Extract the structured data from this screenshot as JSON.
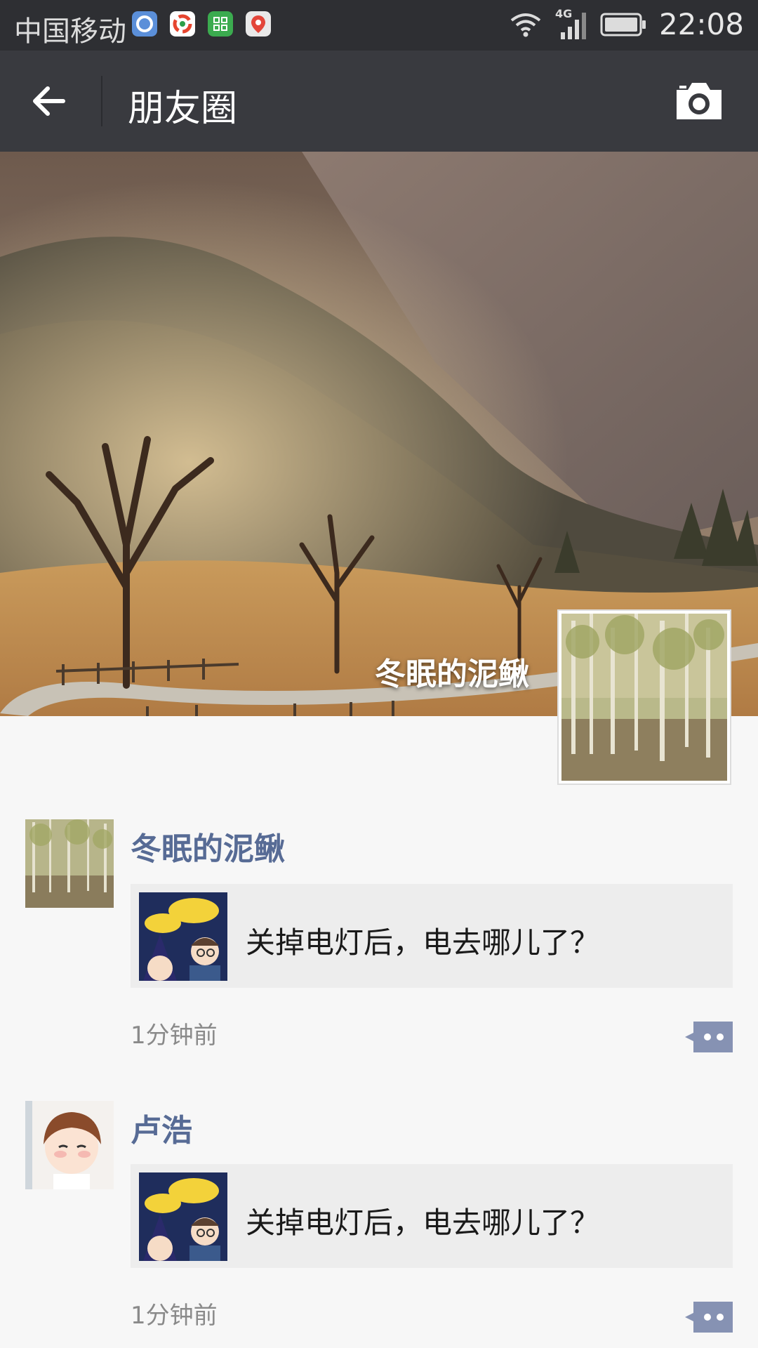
{
  "status_bar": {
    "carrier": "中国移动",
    "network": "4G",
    "time": "22:08"
  },
  "header": {
    "title": "朋友圈",
    "back_icon": "arrow-left-icon",
    "camera_icon": "camera-icon"
  },
  "cover": {
    "username": "冬眠的泥鳅"
  },
  "posts": [
    {
      "author": "冬眠的泥鳅",
      "link_title": "关掉电灯后，电去哪儿了？",
      "time": "1分钟前"
    },
    {
      "author": "卢浩",
      "link_title": "关掉电灯后，电去哪儿了？",
      "time": "1分钟前"
    }
  ],
  "colors": {
    "status_bar": "#2e2f33",
    "title_bar": "#393a3f",
    "name_link": "#576b95",
    "comment_button": "#8692b3"
  }
}
